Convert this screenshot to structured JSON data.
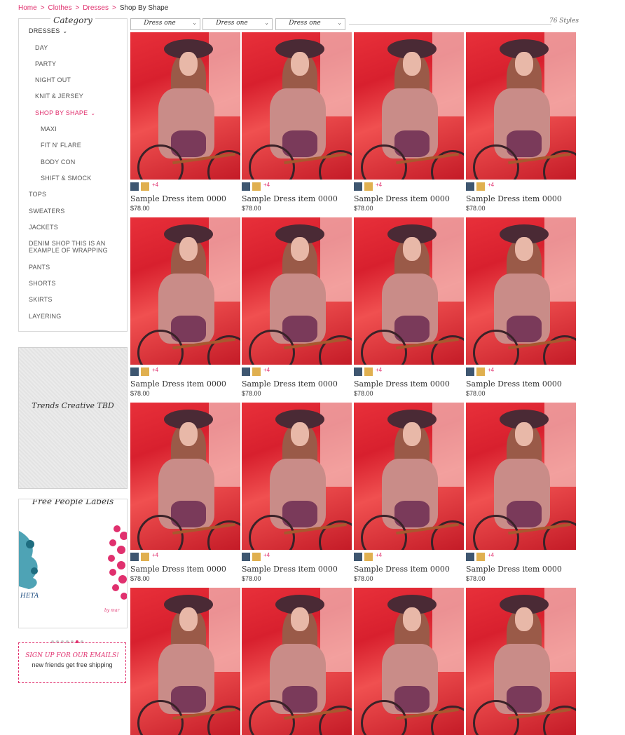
{
  "breadcrumb": {
    "items": [
      "Home",
      "Clothes",
      "Dresses"
    ],
    "separator": ">",
    "current": "Shop By Shape"
  },
  "sidebar": {
    "category_title": "Category",
    "categories": [
      {
        "label": "DRESSES",
        "level": 0,
        "expanded": true
      },
      {
        "label": "DAY",
        "level": 1
      },
      {
        "label": "PARTY",
        "level": 1
      },
      {
        "label": "NIGHT OUT",
        "level": 1
      },
      {
        "label": "KNIT & JERSEY",
        "level": 1
      },
      {
        "label": "SHOP BY SHAPE",
        "level": 1,
        "active": true,
        "expanded": true
      },
      {
        "label": "MAXI",
        "level": 2
      },
      {
        "label": "FIT N' FLARE",
        "level": 2
      },
      {
        "label": "BODY CON",
        "level": 2
      },
      {
        "label": "SHIFT & SMOCK",
        "level": 2
      },
      {
        "label": "TOPS",
        "level": 0
      },
      {
        "label": "SWEATERS",
        "level": 0
      },
      {
        "label": "JACKETS",
        "level": 0
      },
      {
        "label": "DENIM SHOP THIS IS AN",
        "level": 0
      },
      {
        "label": "EXAMPLE OF WRAPPING",
        "level": 0
      },
      {
        "label": "PANTS",
        "level": 0
      },
      {
        "label": "SHORTS",
        "level": 0
      },
      {
        "label": "SKIRTS",
        "level": 0
      },
      {
        "label": "LAYERING",
        "level": 0
      }
    ],
    "trends_label": "Trends Creative TBD",
    "labels_title": "Free People Labels",
    "carousel_dots": 7,
    "carousel_active": 5,
    "signup_title": "SIGN UP FOR OUR EMAILS!",
    "signup_sub": "new friends get free shipping"
  },
  "filters": [
    {
      "label": "Dress one"
    },
    {
      "label": "Dress one"
    },
    {
      "label": "Dress one"
    }
  ],
  "style_count": "76 Styles",
  "colors": {
    "accent": "#e0306e",
    "swatch_blue": "#3e5670",
    "swatch_gold": "#e0b050"
  },
  "products": [
    {
      "name": "Sample Dress item 0000",
      "price": "$78.00",
      "more": "+4"
    },
    {
      "name": "Sample Dress item 0000",
      "price": "$78.00",
      "more": "+4"
    },
    {
      "name": "Sample Dress item 0000",
      "price": "$78.00",
      "more": "+4"
    },
    {
      "name": "Sample Dress item 0000",
      "price": "$78.00",
      "more": "+4"
    },
    {
      "name": "Sample Dress item 0000",
      "price": "$78.00",
      "more": "+4"
    },
    {
      "name": "Sample Dress item 0000",
      "price": "$78.00",
      "more": "+4"
    },
    {
      "name": "Sample Dress item 0000",
      "price": "$78.00",
      "more": "+4"
    },
    {
      "name": "Sample Dress item 0000",
      "price": "$78.00",
      "more": "+4"
    },
    {
      "name": "Sample Dress item 0000",
      "price": "$78.00",
      "more": "+4"
    },
    {
      "name": "Sample Dress item 0000",
      "price": "$78.00",
      "more": "+4"
    },
    {
      "name": "Sample Dress item 0000",
      "price": "$78.00",
      "more": "+4"
    },
    {
      "name": "Sample Dress item 0000",
      "price": "$78.00",
      "more": "+4"
    },
    {
      "name": "",
      "price": "",
      "more": ""
    },
    {
      "name": "",
      "price": "",
      "more": ""
    },
    {
      "name": "",
      "price": "",
      "more": ""
    },
    {
      "name": "",
      "price": "",
      "more": ""
    }
  ]
}
